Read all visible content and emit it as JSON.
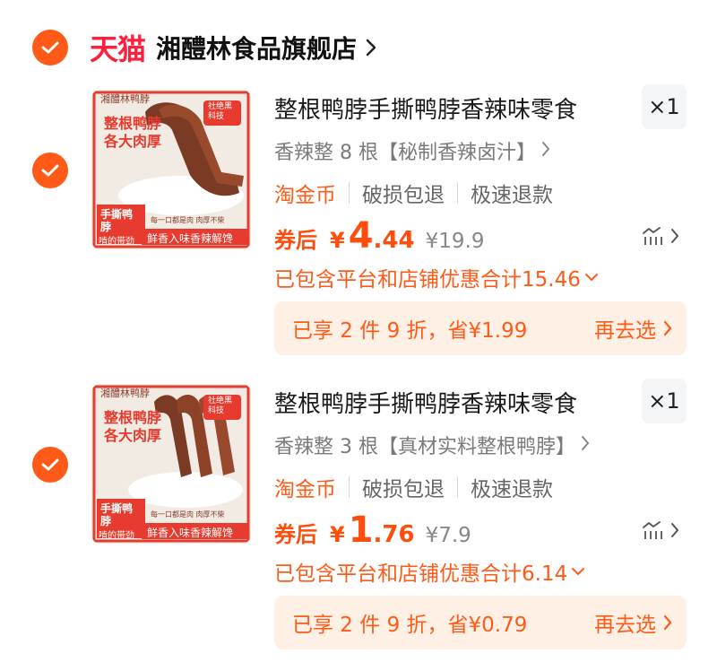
{
  "shop": {
    "platform_logo": "天猫",
    "name": "湘醴林食品旗舰店",
    "brand_color": "#ff1f3d",
    "accent_color": "#ff5a17"
  },
  "items": [
    {
      "image": {
        "brand": "湘醴林鸭脖",
        "badge": "社绝黑科技",
        "headline1": "整根鸭脖",
        "headline2": "各大肉厚",
        "tag1": "手撕鸭脖",
        "tag2": "啃的带劲",
        "slogan": "鲜香入味香辣解馋",
        "small": "每一口都是肉 肉厚不柴"
      },
      "title": "整根鸭脖手撕鸭脖香辣味零食",
      "quantity": "×1",
      "sku": "香辣整 8 根【秘制香辣卤汁】",
      "services": [
        "淘金币",
        "破损包退",
        "极速退款"
      ],
      "coupon_label": "券后",
      "price_symbol": "¥",
      "price_int": "4",
      "price_dec": ".44",
      "original_price": "¥19.9",
      "discount_text": "已包含平台和店铺优惠合计15.46",
      "promo_text": "已享 2 件 9 折，省¥1.99",
      "promo_action": "再去选"
    },
    {
      "image": {
        "brand": "湘醴林鸭脖",
        "badge": "社绝黑科技",
        "headline1": "整根鸭脖",
        "headline2": "各大肉厚",
        "tag1": "手撕鸭脖",
        "tag2": "啃的带劲",
        "slogan": "鲜香入味香辣解馋",
        "small": "每一口都是肉 肉厚不柴"
      },
      "title": "整根鸭脖手撕鸭脖香辣味零食",
      "quantity": "×1",
      "sku": "香辣整 3 根【真材实料整根鸭脖】",
      "services": [
        "淘金币",
        "破损包退",
        "极速退款"
      ],
      "coupon_label": "券后",
      "price_symbol": "¥",
      "price_int": "1",
      "price_dec": ".76",
      "original_price": "¥7.9",
      "discount_text": "已包含平台和店铺优惠合计6.14",
      "promo_text": "已享 2 件 9 折，省¥0.79",
      "promo_action": "再去选"
    }
  ]
}
